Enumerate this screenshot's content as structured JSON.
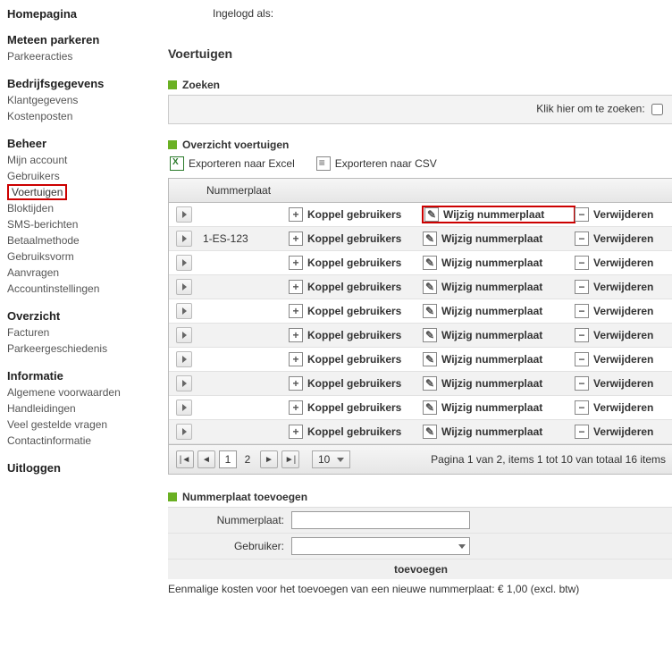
{
  "header": {
    "logged_in_as": "Ingelogd als:"
  },
  "nav": {
    "groups": [
      {
        "header": "Homepagina",
        "items": []
      },
      {
        "header": "Meteen parkeren",
        "items": [
          "Parkeeracties"
        ]
      },
      {
        "header": "Bedrijfsgegevens",
        "items": [
          "Klantgegevens",
          "Kostenposten"
        ]
      },
      {
        "header": "Beheer",
        "items": [
          "Mijn account",
          "Gebruikers",
          "Voertuigen",
          "Bloktijden",
          "SMS-berichten",
          "Betaalmethode",
          "Gebruiksvorm",
          "Aanvragen",
          "Accountinstellingen"
        ]
      },
      {
        "header": "Overzicht",
        "items": [
          "Facturen",
          "Parkeergeschiedenis"
        ]
      },
      {
        "header": "Informatie",
        "items": [
          "Algemene voorwaarden",
          "Handleidingen",
          "Veel gestelde vragen",
          "Contactinformatie"
        ]
      },
      {
        "header": "Uitloggen",
        "items": []
      }
    ],
    "active_item": "Voertuigen"
  },
  "page": {
    "title": "Voertuigen"
  },
  "search": {
    "title": "Zoeken",
    "hint": "Klik hier om te zoeken:"
  },
  "overview": {
    "title": "Overzicht voertuigen",
    "export_excel": "Exporteren naar Excel",
    "export_csv": "Exporteren naar CSV"
  },
  "grid": {
    "columns": {
      "plate": "Nummerplaat"
    },
    "actions": {
      "koppel": "Koppel gebruikers",
      "wijzig": "Wijzig nummerplaat",
      "verwijder": "Verwijderen"
    },
    "rows": [
      {
        "plate": "",
        "highlight": true
      },
      {
        "plate": "1-ES-123"
      },
      {
        "plate": ""
      },
      {
        "plate": ""
      },
      {
        "plate": ""
      },
      {
        "plate": ""
      },
      {
        "plate": ""
      },
      {
        "plate": ""
      },
      {
        "plate": ""
      },
      {
        "plate": ""
      }
    ],
    "pager": {
      "pages": [
        "1",
        "2"
      ],
      "current": "1",
      "page_size": "10",
      "summary": "Pagina 1 van 2, items 1 tot 10 van totaal 16 items"
    }
  },
  "add": {
    "title": "Nummerplaat toevoegen",
    "plate_label": "Nummerplaat:",
    "user_label": "Gebruiker:",
    "submit": "toevoegen",
    "cost_line": "Eenmalige kosten voor het toevoegen van een nieuwe nummerplaat:  € 1,00 (excl. btw)"
  }
}
